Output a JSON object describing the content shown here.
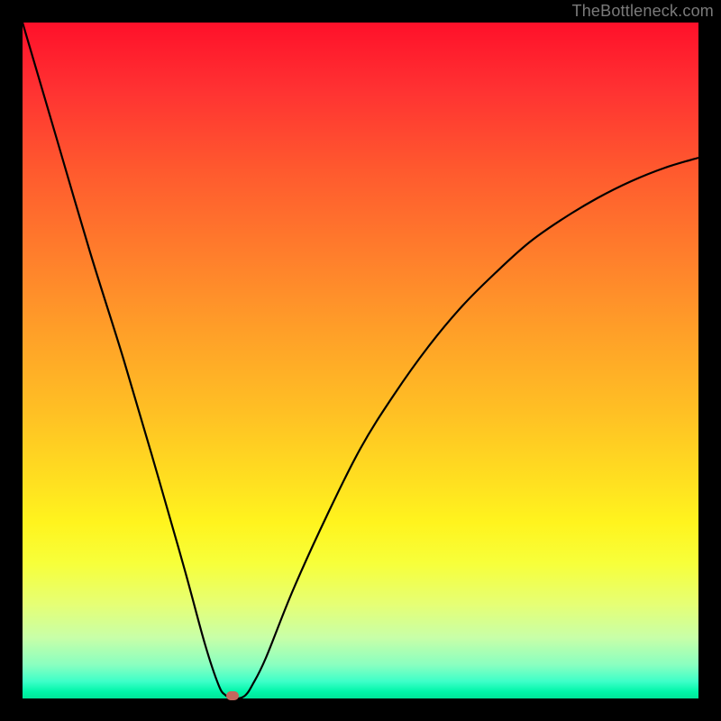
{
  "watermark": "TheBottleneck.com",
  "chart_data": {
    "type": "line",
    "title": "",
    "xlabel": "",
    "ylabel": "",
    "xlim": [
      0,
      100
    ],
    "ylim": [
      0,
      100
    ],
    "series": [
      {
        "name": "curve",
        "x": [
          0,
          5,
          10,
          15,
          20,
          24,
          27,
          29,
          30,
          31,
          32,
          33,
          34,
          36,
          40,
          45,
          50,
          55,
          60,
          65,
          70,
          75,
          80,
          85,
          90,
          95,
          100
        ],
        "values": [
          100,
          83,
          66,
          50,
          33,
          19,
          8,
          2,
          0.5,
          0,
          0,
          0.5,
          2,
          6,
          16,
          27,
          37,
          45,
          52,
          58,
          63,
          67.5,
          71,
          74,
          76.5,
          78.5,
          80
        ]
      }
    ],
    "marker": {
      "x": 31,
      "y": 0,
      "color": "#c4675d"
    },
    "colors": {
      "frame": "#000000",
      "curve": "#000000",
      "gradient_top": "#ff102a",
      "gradient_bottom": "#00e598"
    }
  }
}
